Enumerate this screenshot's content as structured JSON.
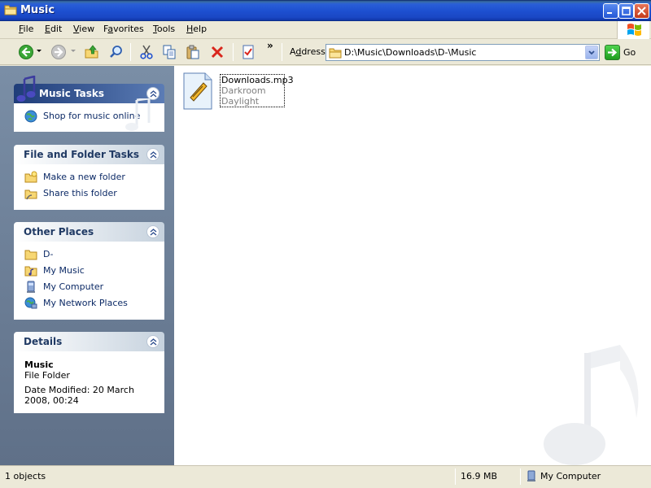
{
  "window": {
    "title": "Music",
    "icon": "folder-icon"
  },
  "menu": {
    "items": [
      {
        "label": "File",
        "accel": "F"
      },
      {
        "label": "Edit",
        "accel": "E"
      },
      {
        "label": "View",
        "accel": "V"
      },
      {
        "label": "Favorites",
        "accel": "a"
      },
      {
        "label": "Tools",
        "accel": "T"
      },
      {
        "label": "Help",
        "accel": "H"
      }
    ]
  },
  "toolbar": {
    "chevron": "»",
    "icons": [
      "back-icon",
      "forward-icon",
      "up-icon",
      "search-icon",
      "cut-icon",
      "copy-icon",
      "paste-icon",
      "delete-icon",
      "properties-icon"
    ]
  },
  "address": {
    "label": "Address",
    "value": "D:\\Music\\Downloads\\D-\\Music",
    "go_label": "Go"
  },
  "panels": {
    "music_tasks": {
      "title": "Music Tasks",
      "items": [
        {
          "label": "Shop for music online",
          "icon": "globe-icon"
        }
      ]
    },
    "file_folder_tasks": {
      "title": "File and Folder Tasks",
      "items": [
        {
          "label": "Make a new folder",
          "icon": "new-folder-icon"
        },
        {
          "label": "Share this folder",
          "icon": "share-folder-icon"
        }
      ]
    },
    "other_places": {
      "title": "Other Places",
      "items": [
        {
          "label": "D-",
          "icon": "folder-icon"
        },
        {
          "label": "My Music",
          "icon": "my-music-icon"
        },
        {
          "label": "My Computer",
          "icon": "computer-icon"
        },
        {
          "label": "My Network Places",
          "icon": "network-icon"
        }
      ]
    },
    "details": {
      "title": "Details",
      "name": "Music",
      "type": "File Folder",
      "modified": "Date Modified: 20 March 2008, 00:24"
    }
  },
  "files": [
    {
      "name": "Downloads.mp3",
      "artist": "Darkroom",
      "album": "Daylight",
      "icon": "winamp-file-icon"
    }
  ],
  "status": {
    "objects": "1 objects",
    "size": "16.9 MB",
    "location": "My Computer"
  },
  "colors": {
    "titlebar": "#1d4fd0",
    "leftpane": "#6b7d95",
    "panel_link": "#0c2a66",
    "special_header": "#1f3d79"
  }
}
